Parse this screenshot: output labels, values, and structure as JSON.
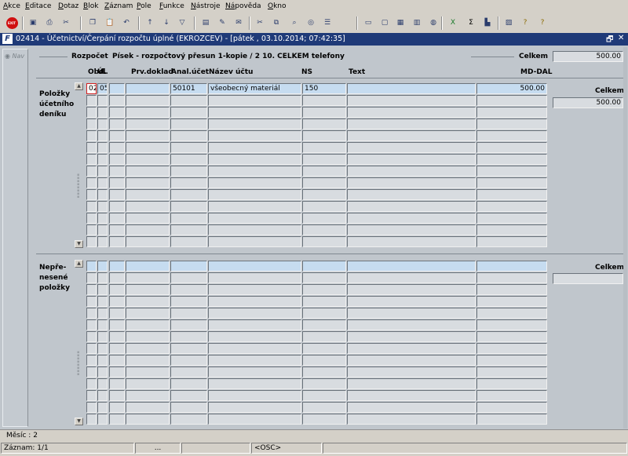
{
  "menu": [
    {
      "u": "A",
      "rest": "kce"
    },
    {
      "u": "E",
      "rest": "ditace"
    },
    {
      "u": "D",
      "rest": "otaz"
    },
    {
      "u": "B",
      "rest": "lok"
    },
    {
      "u": "Z",
      "rest": "áznam"
    },
    {
      "u": "P",
      "rest": "ole"
    },
    {
      "u": "F",
      "rest": "unkce"
    },
    {
      "u": "N",
      "rest": "ástroje"
    },
    {
      "u": "Ná",
      "rest": "pověda"
    },
    {
      "u": "O",
      "rest": "kno"
    }
  ],
  "toolbar": {
    "exit_label": "EXIT",
    "icons": [
      "save-icon",
      "print-icon",
      "cut-icon",
      "copy-icon",
      "paste-icon",
      "undo-icon",
      "sort-asc-icon",
      "sort-desc-icon",
      "filter-icon",
      "print-preview-icon",
      "edit-icon",
      "mail-icon",
      "scissors-icon",
      "clip-icon",
      "search-icon",
      "find-record-icon",
      "list-icon",
      "insert-icon",
      "delete-icon",
      "calculator-icon",
      "document-icon",
      "globe-icon",
      "excel-icon",
      "sum-icon",
      "chart-icon",
      "image-icon",
      "help-icon",
      "context-help-icon"
    ]
  },
  "window": {
    "title": "02414 - Účetnictví/Čerpání rozpočtu úplné (EKROZCEV) - [pátek , 03.10.2014; 07:42:35]",
    "logo_text": "F",
    "restore_glyph": "🗗",
    "close_glyph": "✕"
  },
  "nav": {
    "label": "Nav"
  },
  "header": {
    "rozpocet_label": "Rozpočet",
    "rozpocet_value": "Písek - rozpočtový přesun 1-kopie / 2 10.  CELKEM telefony",
    "celkem_label": "Celkem",
    "celkem_value": "500.00"
  },
  "columns": [
    "Obd.",
    "Úl.",
    "Prv.doklad",
    "Anal.účet",
    "Název účtu",
    "NS",
    "Text",
    "MD-DAL"
  ],
  "polozky": {
    "label": "Položky účetního deníku",
    "celkem_label": "Celkem",
    "celkem_value": "500.00",
    "row_count": 14,
    "rows": [
      {
        "obd": "02",
        "ul": "05",
        "prv": "",
        "anal": "50101",
        "nazev": "všeobecný materiál",
        "ns": "150",
        "text": "",
        "md": "500.00"
      }
    ]
  },
  "neprenesene": {
    "label": "Nepře-nesené položky",
    "celkem_label": "Celkem",
    "celkem_value": "",
    "row_count": 14,
    "rows": []
  },
  "status": {
    "mesic": "Měsíc : 2",
    "zaznam": "Záznam: 1/1",
    "dots": "...",
    "osc": "<OSC>"
  }
}
